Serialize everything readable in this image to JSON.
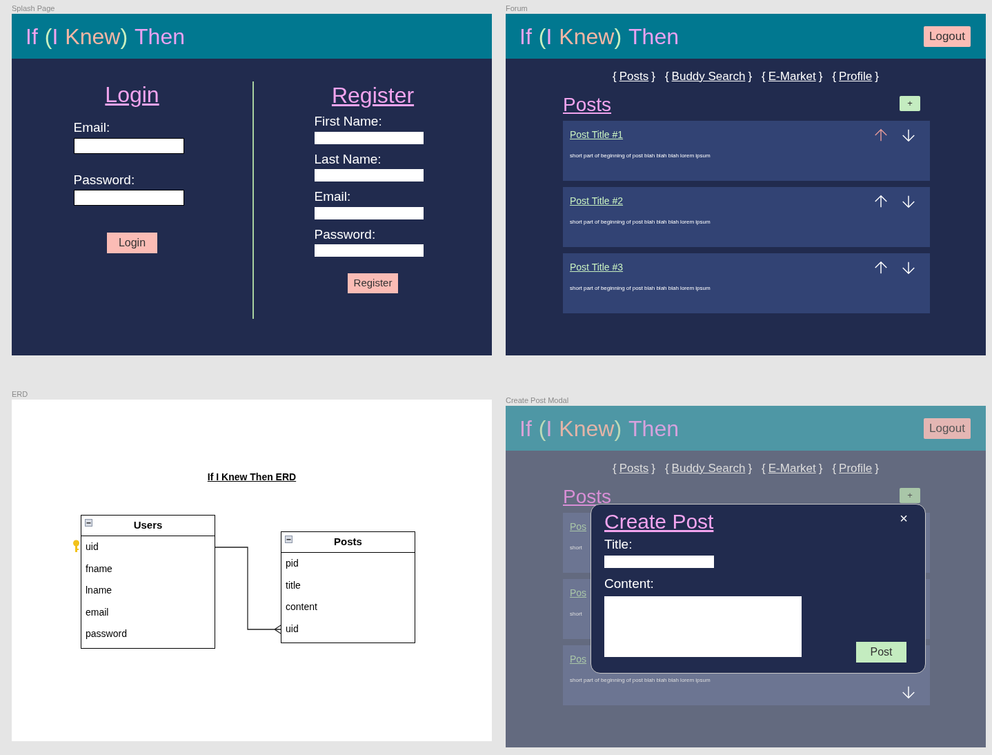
{
  "splash": {
    "label": "Splash Page",
    "brand": [
      {
        "text": "If",
        "color": "#f2a4ee"
      },
      {
        "text": "(",
        "color": "#c8f0c0"
      },
      {
        "text": "I",
        "color": "#f2a4ee"
      },
      {
        "text": "Knew",
        "color": "#f7b6a4"
      },
      {
        "text": ")",
        "color": "#c8f0c0"
      },
      {
        "text": "Then",
        "color": "#eaa2f2"
      }
    ],
    "login": {
      "heading": "Login",
      "fields": [
        {
          "label": "Email:"
        },
        {
          "label": "Password:"
        }
      ],
      "button": "Login"
    },
    "register": {
      "heading": "Register",
      "fields": [
        {
          "label": "First Name:"
        },
        {
          "label": "Last Name:"
        },
        {
          "label": "Email:"
        },
        {
          "label": "Password:"
        }
      ],
      "button": "Register"
    }
  },
  "forum": {
    "label": "Forum",
    "dimmed": false,
    "brand": [
      {
        "text": "If",
        "color": "#f2a4ee"
      },
      {
        "text": "(",
        "color": "#c8f0c0"
      },
      {
        "text": "I",
        "color": "#f2a4ee"
      },
      {
        "text": "Knew",
        "color": "#f7b6a4"
      },
      {
        "text": ")",
        "color": "#c8f0c0"
      },
      {
        "text": "Then",
        "color": "#eaa2f2"
      }
    ],
    "logout": "Logout",
    "nav": [
      {
        "open": "{",
        "label": "Posts",
        "close": "}"
      },
      {
        "open": "{",
        "label": "Buddy Search",
        "close": "}"
      },
      {
        "open": "{",
        "label": "E-Market",
        "close": "}"
      },
      {
        "open": "{",
        "label": "Profile",
        "close": "}"
      }
    ],
    "posts_heading": "Posts",
    "add_button": "+",
    "posts": [
      {
        "title": "Post Title #1",
        "excerpt": "short part of beginning of post blah blah blah lorem ipsum",
        "arrows": [
          {
            "kind": "up",
            "active": true
          },
          {
            "kind": "down",
            "active": false
          }
        ]
      },
      {
        "title": "Post Title #2",
        "excerpt": "short part of beginning of post blah blah blah lorem ipsum",
        "arrows": [
          {
            "kind": "up",
            "active": false
          },
          {
            "kind": "down",
            "active": false
          }
        ]
      },
      {
        "title": "Post Title #3",
        "excerpt": "short part of beginning of post blah blah blah lorem ipsum",
        "arrows": [
          {
            "kind": "up",
            "active": false
          },
          {
            "kind": "down",
            "active": false
          }
        ]
      }
    ]
  },
  "erd": {
    "label": "ERD",
    "title": "If I Knew Then ERD",
    "entities": [
      {
        "name": "Users",
        "fields": [
          {
            "name": "uid",
            "key": true
          },
          {
            "name": "fname",
            "key": false
          },
          {
            "name": "lname",
            "key": false
          },
          {
            "name": "email",
            "key": false
          },
          {
            "name": "password",
            "key": false
          }
        ]
      },
      {
        "name": "Posts",
        "fields": [
          {
            "name": "pid",
            "key": false
          },
          {
            "name": "title",
            "key": false
          },
          {
            "name": "content",
            "key": false
          },
          {
            "name": "uid",
            "key": false
          }
        ]
      }
    ]
  },
  "modal_frame": {
    "label": "Create Post Modal",
    "dimmed": true,
    "brand": [
      {
        "text": "If",
        "color": "#d9a3d8"
      },
      {
        "text": "(",
        "color": "#bcdab8"
      },
      {
        "text": "I",
        "color": "#d9a3d8"
      },
      {
        "text": "Knew",
        "color": "#e4b4a7"
      },
      {
        "text": ")",
        "color": "#bcdab8"
      },
      {
        "text": "Then",
        "color": "#d6a2de"
      }
    ],
    "logout": "Logout",
    "nav": [
      {
        "open": "{",
        "label": "Posts",
        "close": "}"
      },
      {
        "open": "{",
        "label": "Buddy Search",
        "close": "}"
      },
      {
        "open": "{",
        "label": "E-Market",
        "close": "}"
      },
      {
        "open": "{",
        "label": "Profile",
        "close": "}"
      }
    ],
    "posts_heading": "Posts",
    "add_button": "+",
    "posts": [
      {
        "title": "Pos",
        "excerpt": "short"
      },
      {
        "title": "Pos",
        "excerpt": "short"
      },
      {
        "title": "Pos",
        "excerpt": "short part of beginning of post blah blah blah lorem ipsum",
        "arrows": [
          {
            "kind": "down",
            "active": false
          }
        ]
      }
    ],
    "modal": {
      "title": "Create Post",
      "close": "×",
      "fields": [
        {
          "label": "Title:",
          "kind": "line"
        },
        {
          "label": "Content:",
          "kind": "area"
        }
      ],
      "button": "Post"
    }
  }
}
